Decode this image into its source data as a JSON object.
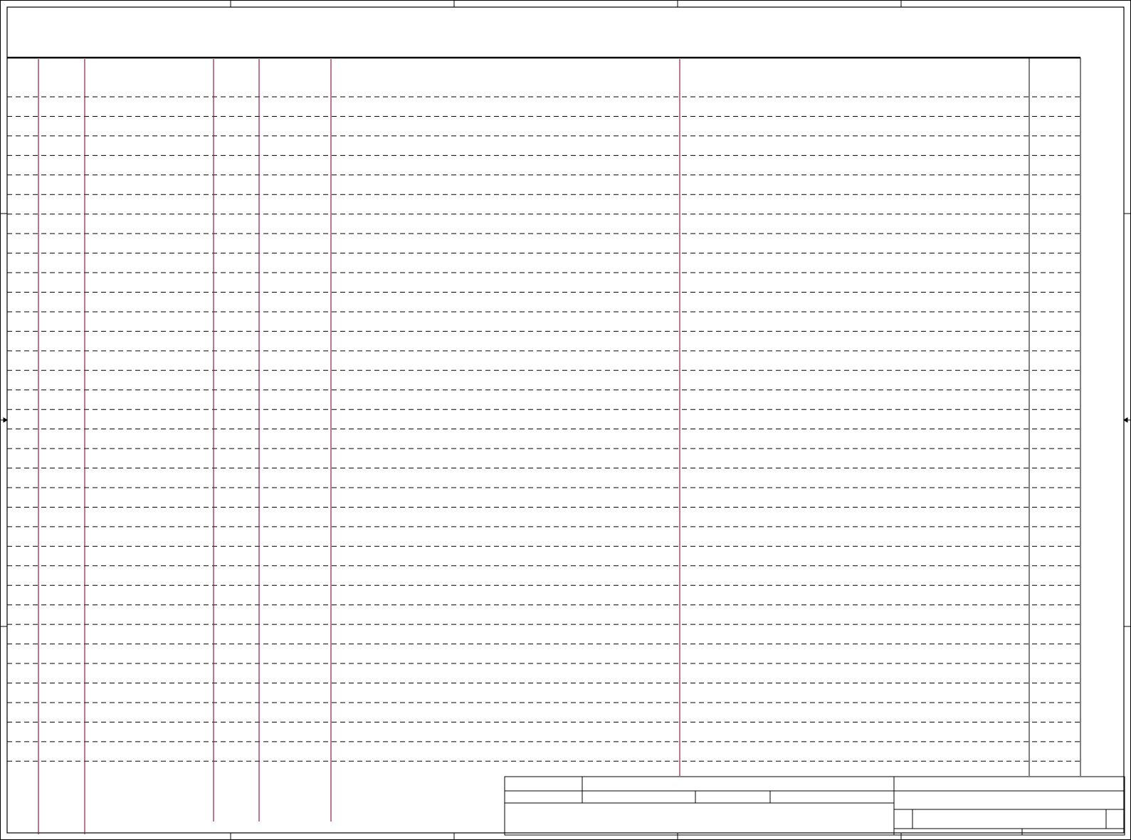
{
  "document": {
    "type": "blank drawing sheet form",
    "colors": {
      "frame": "#000000",
      "column_lines": "#8b1a4a",
      "row_lines": "#000000",
      "background": "#ffffff"
    },
    "table": {
      "row_count": 35,
      "row_style": "dashed",
      "column_count": 9
    },
    "title_block": {
      "fields": []
    }
  }
}
